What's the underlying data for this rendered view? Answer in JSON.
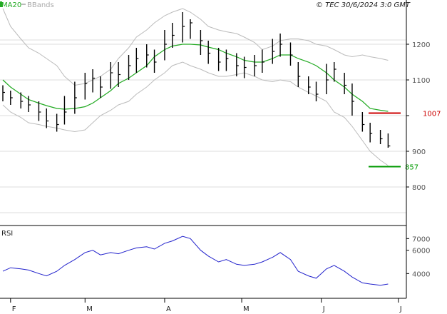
{
  "header": {
    "ma_legend": "MA20",
    "bb_legend": "BBands",
    "stamp": "© TEC 30/6/2024 3:0 GMT"
  },
  "colors": {
    "price": "#000000",
    "ma": "#22aa22",
    "bands": "#bbbbbb",
    "rsi": "#2222cc",
    "resistance": "#cc0000",
    "support": "#009900",
    "grid": "#dddddd",
    "axis": "#000000"
  },
  "chart_data": [
    {
      "type": "ohlc",
      "title": "",
      "x": [
        "2024-01-29",
        "2024-02-01",
        "2024-02-05",
        "2024-02-08",
        "2024-02-12",
        "2024-02-15",
        "2024-02-19",
        "2024-02-22",
        "2024-02-26",
        "2024-03-01",
        "2024-03-04",
        "2024-03-07",
        "2024-03-11",
        "2024-03-14",
        "2024-03-18",
        "2024-03-21",
        "2024-03-25",
        "2024-03-28",
        "2024-04-01",
        "2024-04-04",
        "2024-04-08",
        "2024-04-11",
        "2024-04-15",
        "2024-04-18",
        "2024-04-22",
        "2024-04-25",
        "2024-04-29",
        "2024-05-02",
        "2024-05-06",
        "2024-05-09",
        "2024-05-13",
        "2024-05-16",
        "2024-05-20",
        "2024-05-23",
        "2024-05-27",
        "2024-05-30",
        "2024-06-03",
        "2024-06-06",
        "2024-06-10",
        "2024-06-13",
        "2024-06-17",
        "2024-06-20",
        "2024-06-24",
        "2024-06-27"
      ],
      "series": [
        {
          "name": "",
          "close": [
            1065,
            1050,
            1040,
            1030,
            1010,
            985,
            975,
            1010,
            1050,
            1090,
            1105,
            1080,
            1120,
            1115,
            1140,
            1160,
            1170,
            1150,
            1200,
            1225,
            1250,
            1260,
            1210,
            1175,
            1150,
            1160,
            1140,
            1135,
            1140,
            1150,
            1180,
            1200,
            1170,
            1110,
            1080,
            1060,
            1100,
            1130,
            1085,
            1040,
            975,
            950,
            935,
            915
          ],
          "high": [
            1085,
            1070,
            1065,
            1055,
            1040,
            1020,
            1005,
            1055,
            1095,
            1120,
            1130,
            1110,
            1150,
            1150,
            1170,
            1190,
            1200,
            1185,
            1240,
            1260,
            1290,
            1270,
            1240,
            1210,
            1190,
            1185,
            1175,
            1165,
            1170,
            1185,
            1215,
            1230,
            1205,
            1150,
            1110,
            1095,
            1145,
            1150,
            1120,
            1090,
            1010,
            980,
            960,
            950
          ],
          "low": [
            1040,
            1030,
            1020,
            1010,
            985,
            965,
            955,
            975,
            1005,
            1045,
            1065,
            1050,
            1075,
            1080,
            1100,
            1120,
            1135,
            1120,
            1155,
            1190,
            1205,
            1215,
            1170,
            1145,
            1125,
            1125,
            1110,
            1105,
            1110,
            1120,
            1145,
            1165,
            1140,
            1080,
            1060,
            1040,
            1060,
            1095,
            1060,
            1000,
            955,
            925,
            920,
            910
          ]
        },
        {
          "name": "MA20",
          "values": [
            1100,
            1080,
            1060,
            1045,
            1035,
            1028,
            1020,
            1018,
            1020,
            1025,
            1035,
            1050,
            1070,
            1090,
            1105,
            1120,
            1140,
            1165,
            1185,
            1195,
            1200,
            1200,
            1198,
            1192,
            1185,
            1175,
            1165,
            1155,
            1150,
            1150,
            1160,
            1170,
            1170,
            1160,
            1150,
            1140,
            1120,
            1100,
            1080,
            1060,
            1040,
            1020,
            1015,
            1012
          ]
        },
        {
          "name": "BBands",
          "upper": [
            1300,
            1250,
            1215,
            1190,
            1175,
            1160,
            1140,
            1110,
            1085,
            1090,
            1100,
            1110,
            1130,
            1160,
            1190,
            1220,
            1240,
            1260,
            1280,
            1290,
            1300,
            1290,
            1270,
            1250,
            1240,
            1235,
            1230,
            1220,
            1205,
            1185,
            1195,
            1210,
            1215,
            1215,
            1210,
            1200,
            1195,
            1185,
            1170,
            1165,
            1170,
            1165,
            1160,
            1155
          ],
          "lower": [
            1030,
            1010,
            995,
            980,
            975,
            970,
            965,
            960,
            955,
            960,
            980,
            1000,
            1015,
            1030,
            1040,
            1060,
            1080,
            1100,
            1120,
            1140,
            1150,
            1140,
            1130,
            1120,
            1110,
            1110,
            1115,
            1120,
            1110,
            1100,
            1095,
            1100,
            1095,
            1080,
            1065,
            1055,
            1040,
            1010,
            995,
            970,
            930,
            900,
            875,
            860
          ]
        }
      ],
      "y_ticks": [
        800,
        900,
        1000,
        1100,
        1200
      ],
      "y_tick_labels": [
        "800",
        "900",
        "",
        "1100",
        "1200"
      ],
      "ylim": [
        700,
        1300
      ],
      "levels": [
        {
          "name": "resistance",
          "value": 1007,
          "label": "1007"
        },
        {
          "name": "support",
          "value": 857,
          "label": "857"
        }
      ],
      "grid": true
    },
    {
      "type": "line",
      "title": "RSI",
      "x": [
        "2024-01-29",
        "2024-02-01",
        "2024-02-05",
        "2024-02-08",
        "2024-02-12",
        "2024-02-15",
        "2024-02-19",
        "2024-02-22",
        "2024-02-26",
        "2024-03-01",
        "2024-03-04",
        "2024-03-07",
        "2024-03-11",
        "2024-03-14",
        "2024-03-18",
        "2024-03-21",
        "2024-03-25",
        "2024-03-28",
        "2024-04-01",
        "2024-04-04",
        "2024-04-08",
        "2024-04-11",
        "2024-04-15",
        "2024-04-18",
        "2024-04-22",
        "2024-04-25",
        "2024-04-29",
        "2024-05-02",
        "2024-05-06",
        "2024-05-09",
        "2024-05-13",
        "2024-05-16",
        "2024-05-20",
        "2024-05-23",
        "2024-05-27",
        "2024-05-30",
        "2024-06-03",
        "2024-06-06",
        "2024-06-10",
        "2024-06-13",
        "2024-06-17",
        "2024-06-20",
        "2024-06-24",
        "2024-06-27"
      ],
      "series": [
        {
          "name": "RSI",
          "values": [
            42,
            45,
            44,
            43,
            40,
            38,
            42,
            47,
            52,
            58,
            60,
            56,
            58,
            57,
            60,
            62,
            63,
            61,
            66,
            68,
            72,
            70,
            60,
            55,
            50,
            52,
            48,
            47,
            48,
            50,
            54,
            58,
            52,
            42,
            38,
            36,
            44,
            47,
            42,
            37,
            32,
            31,
            30,
            31
          ]
        }
      ],
      "y_ticks": [
        40,
        60,
        70
      ],
      "y_tick_labels": [
        "4000",
        "6000",
        "7000"
      ],
      "ylim": [
        20,
        80
      ]
    }
  ],
  "x_axis": {
    "ticks": [
      {
        "date": "2024-02-01",
        "label": "F"
      },
      {
        "date": "2024-03-01",
        "label": "M"
      },
      {
        "date": "2024-04-01",
        "label": "A"
      },
      {
        "date": "2024-05-01",
        "label": "M"
      },
      {
        "date": "2024-06-01",
        "label": "J"
      },
      {
        "date": "2024-07-01",
        "label": "J"
      }
    ]
  }
}
